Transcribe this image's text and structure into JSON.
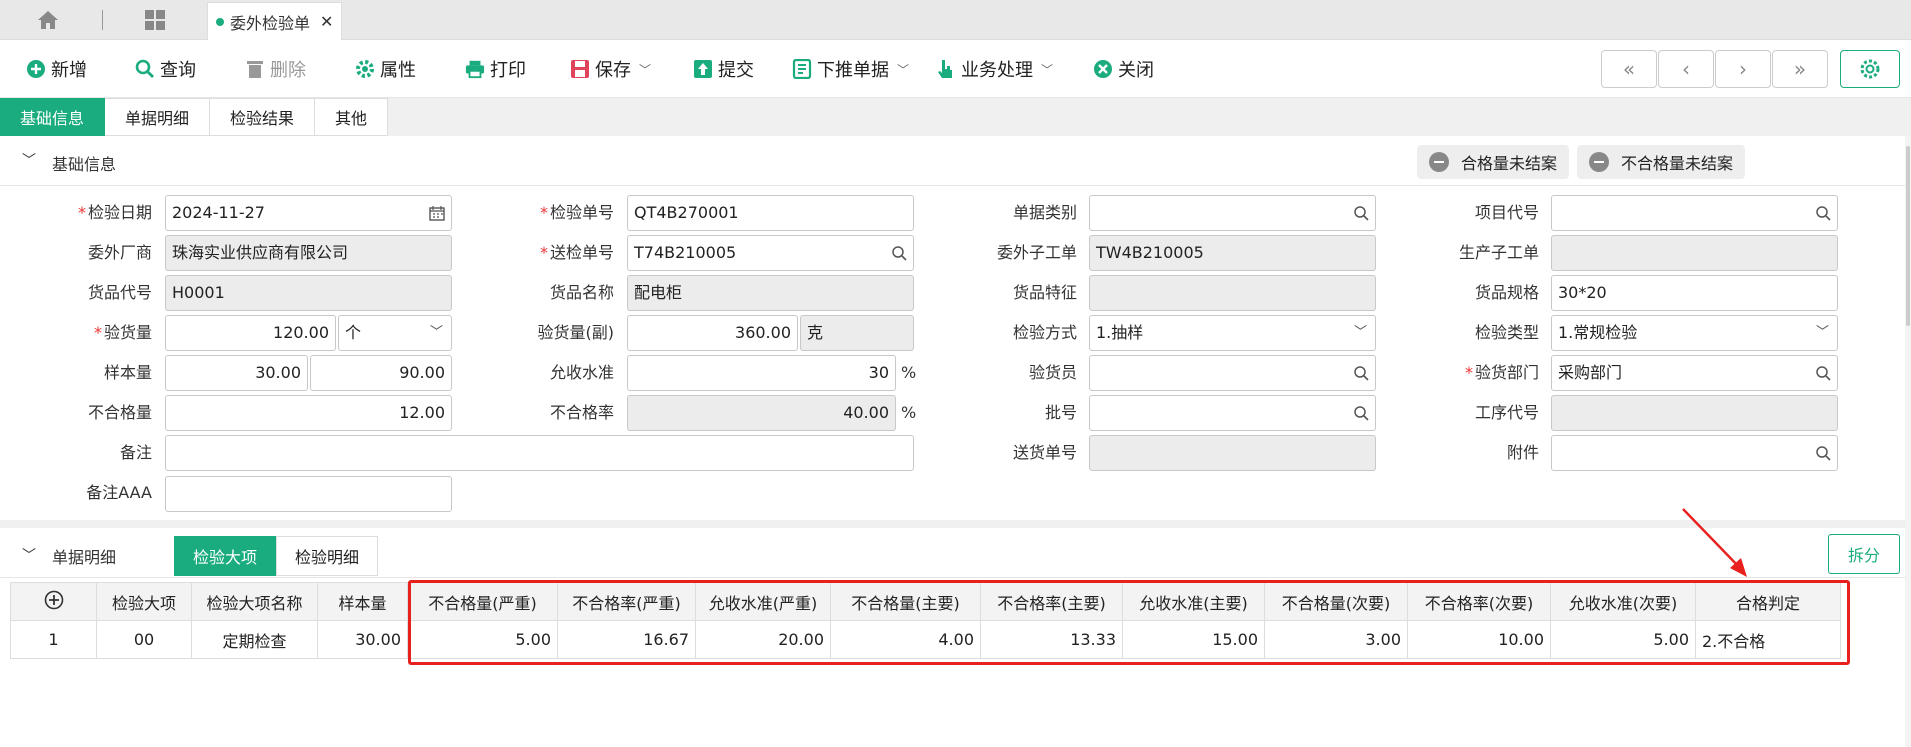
{
  "topbar": {
    "open_tab": "委外检验单"
  },
  "toolbar": {
    "new": "新增",
    "query": "查询",
    "delete": "删除",
    "props": "属性",
    "print": "打印",
    "save": "保存",
    "submit": "提交",
    "push": "下推单据",
    "business": "业务处理",
    "close": "关闭"
  },
  "tabs": [
    "基础信息",
    "单据明细",
    "检验结果",
    "其他"
  ],
  "basic": {
    "title": "基础信息",
    "pill1": "合格量未结案",
    "pill2": "不合格量未结案",
    "labels": {
      "inspect_date": "检验日期",
      "inspect_no": "检验单号",
      "doc_type": "单据类别",
      "project_code": "项目代号",
      "vendor": "委外厂商",
      "send_no": "送检单号",
      "sub_order": "委外子工单",
      "prod_order": "生产子工单",
      "item_code": "货品代号",
      "item_name": "货品名称",
      "item_feature": "货品特征",
      "item_spec": "货品规格",
      "qty": "验货量",
      "qty2": "验货量(副)",
      "method": "检验方式",
      "type": "检验类型",
      "sample": "样本量",
      "aql": "允收水准",
      "inspector": "验货员",
      "dept": "验货部门",
      "ng_qty": "不合格量",
      "ng_rate": "不合格率",
      "batch": "批号",
      "process": "工序代号",
      "remark": "备注",
      "delivery_no": "送货单号",
      "attach": "附件",
      "remark_aaa": "备注AAA"
    },
    "values": {
      "inspect_date": "2024-11-27",
      "inspect_no": "QT4B270001",
      "vendor": "珠海实业供应商有限公司",
      "send_no": "T74B210005",
      "sub_order": "TW4B210005",
      "item_code": "H0001",
      "item_name": "配电柜",
      "item_spec": "30*20",
      "qty": "120.00",
      "qty_unit": "个",
      "qty2": "360.00",
      "qty2_unit": "克",
      "method": "1.抽样",
      "type": "1.常规检验",
      "sample1": "30.00",
      "sample2": "90.00",
      "aql": "30",
      "dept": "采购部门",
      "ng_qty": "12.00",
      "ng_rate": "40.00",
      "pct": "%"
    }
  },
  "detail": {
    "title": "单据明细",
    "tabs": [
      "检验大项",
      "检验明细"
    ],
    "split": "拆分",
    "columns": [
      "检验大项",
      "检验大项名称",
      "样本量",
      "不合格量(严重)",
      "不合格率(严重)",
      "允收水准(严重)",
      "不合格量(主要)",
      "不合格率(主要)",
      "允收水准(主要)",
      "不合格量(次要)",
      "不合格率(次要)",
      "允收水准(次要)",
      "合格判定"
    ],
    "row": [
      "1",
      "00",
      "定期检查",
      "30.00",
      "5.00",
      "16.67",
      "20.00",
      "4.00",
      "13.33",
      "15.00",
      "3.00",
      "10.00",
      "5.00",
      "2.不合格"
    ]
  },
  "colors": {
    "accent": "#1aac7e",
    "highlight": "#e8201e"
  }
}
